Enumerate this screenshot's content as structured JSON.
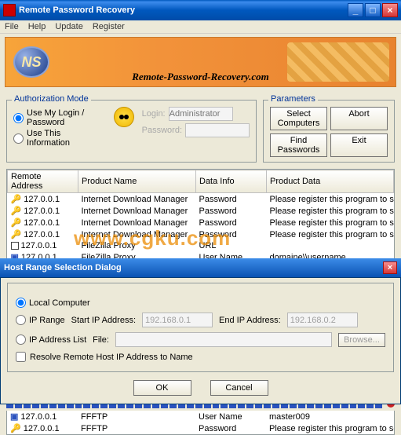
{
  "window": {
    "title": "Remote Password Recovery"
  },
  "menu": [
    "File",
    "Help",
    "Update",
    "Register"
  ],
  "banner": {
    "logo": "NS",
    "domain": "Remote-Password-Recovery.com"
  },
  "auth": {
    "legend": "Authorization Mode",
    "opt1": "Use My Login / Password",
    "opt2": "Use This Information",
    "login_label": "Login:",
    "password_label": "Password:",
    "admin_placeholder": "Administrator"
  },
  "params": {
    "legend": "Parameters",
    "select": "Select Computers",
    "abort": "Abort",
    "find": "Find Passwords",
    "exit": "Exit"
  },
  "columns": {
    "ra": "Remote Address",
    "pn": "Product Name",
    "di": "Data Info",
    "pd": "Product Data"
  },
  "rows": [
    {
      "icon": "key",
      "addr": "127.0.0.1",
      "prod": "Internet Download Manager",
      "info": "Password",
      "data": "Please register this program to see the Passw"
    },
    {
      "icon": "key",
      "addr": "127.0.0.1",
      "prod": "Internet Download Manager",
      "info": "Password",
      "data": "Please register this program to see the Passw"
    },
    {
      "icon": "key",
      "addr": "127.0.0.1",
      "prod": "Internet Download Manager",
      "info": "Password",
      "data": "Please register this program to see the Passw"
    },
    {
      "icon": "key",
      "addr": "127.0.0.1",
      "prod": "Internet Download Manager",
      "info": "Password",
      "data": "Please register this program to see the Passw"
    },
    {
      "icon": "sq",
      "addr": "127.0.0.1",
      "prod": "FileZilla Proxy",
      "info": "URL",
      "data": ""
    },
    {
      "icon": "blue",
      "addr": "127.0.0.1",
      "prod": "FileZilla Proxy",
      "info": "User Name",
      "data": "domaine\\\\username"
    }
  ],
  "watermark": "www.cgku.com",
  "dialog": {
    "title": "Host Range Selection Dialog",
    "opt_local": "Local Computer",
    "opt_range": "IP Range",
    "opt_list": "IP Address List",
    "start_label": "Start IP Address:",
    "end_label": "End IP Address:",
    "file_label": "File:",
    "start_ph": "192.168.0.1",
    "end_ph": "192.168.0.2",
    "browse": "Browse...",
    "resolve": "Resolve Remote Host IP Address to Name",
    "ok": "OK",
    "cancel": "Cancel"
  },
  "tail": [
    {
      "icon": "blue",
      "addr": "127.0.0.1",
      "prod": "FFFTP",
      "info": "User Name",
      "data": "master009"
    },
    {
      "icon": "key",
      "addr": "127.0.0.1",
      "prod": "FFFTP",
      "info": "Password",
      "data": "Please register this program to see the Passw"
    }
  ]
}
